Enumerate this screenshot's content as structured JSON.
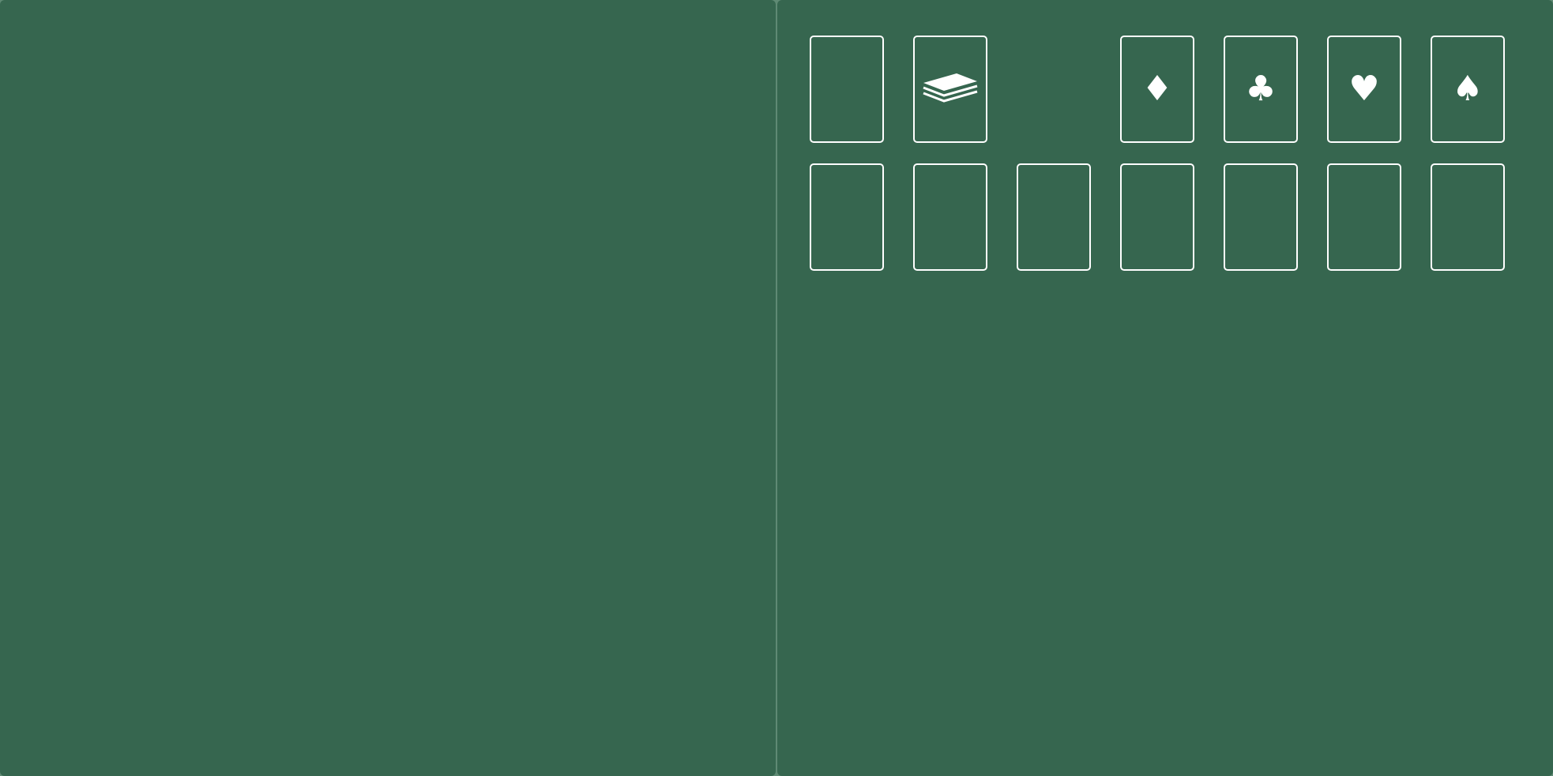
{
  "colors": {
    "felt": "#36664f",
    "divider": "#5f8a74",
    "outline": "#ffffff"
  },
  "board": {
    "stock": {
      "icon": "empty-stock"
    },
    "waste": {
      "icon": "card-stack-icon"
    },
    "foundations": [
      {
        "suit": "diamonds",
        "icon": "diamond-icon",
        "glyph": "♦"
      },
      {
        "suit": "clubs",
        "icon": "club-icon",
        "glyph": "♣"
      },
      {
        "suit": "hearts",
        "icon": "heart-icon",
        "glyph": "♥"
      },
      {
        "suit": "spades",
        "icon": "spade-icon",
        "glyph": "♠"
      }
    ],
    "tableau_count": 7
  }
}
